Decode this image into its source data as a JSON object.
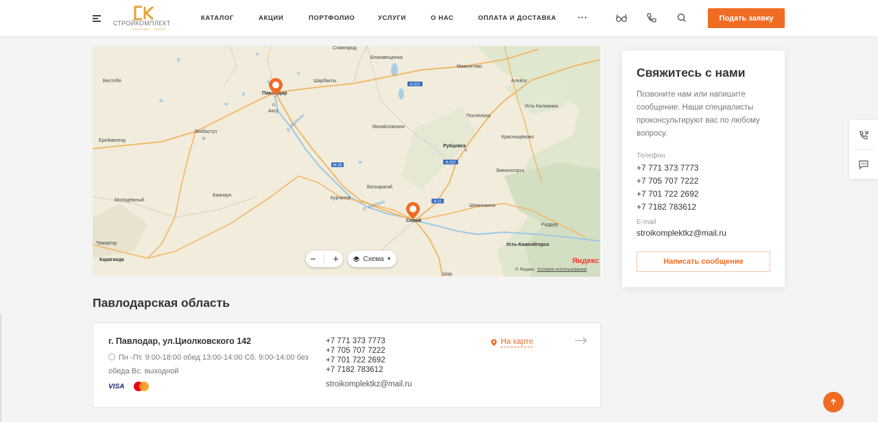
{
  "header": {
    "logo_text": "СТРОЙКОМПЛЕКТ",
    "logo_sub": "ПАВЛОДАР · СЕМЕЙ",
    "nav": [
      "КАТАЛОГ",
      "АКЦИИ",
      "ПОРТФОЛИО",
      "УСЛУГИ",
      "О НАС",
      "ОПЛАТА И ДОСТАВКА"
    ],
    "more": "···",
    "apply_button": "Подать заявку",
    "icons": [
      "menu-icon",
      "glasses-icon",
      "phone-icon",
      "search-icon"
    ]
  },
  "map": {
    "labels": [
      "Бестобе",
      "Павлодар",
      "Аксу",
      "Шарбакты",
      "Благовещенка",
      "Мамонтово",
      "Алейск",
      "Усть-Калманка",
      "Экибастуз",
      "Ерейментау",
      "Михайловское",
      "Поспелиха",
      "Рубцовск",
      "Краснощёково",
      "Змеиногорск",
      "Бескарагай",
      "Баянаул",
      "Курчатов",
      "Молодёжный",
      "Шемонаиха",
      "Семей",
      "Риддер",
      "Темиртау",
      "Караганда",
      "Усть-Каменогорск",
      "Шар",
      "Славгород",
      "р. Иртыш"
    ],
    "roads": [
      "А-321",
      "М-38",
      "А-322",
      "А-11"
    ],
    "zoom_out": "−",
    "zoom_in": "+",
    "scheme_label": "Схема",
    "yandex": "Яндекс",
    "copyright": "© Яндекс",
    "terms": "Условия использования"
  },
  "region": {
    "title": "Павлодарская область"
  },
  "office": {
    "address": "г. Павлодар, ул.Циолковского 142",
    "hours": "Пн -Пт. 9:00-18:00 обед 13:00-14:00 Сб. 9:00-14:00 без обеда Вс. выходной",
    "phones": [
      "+7 771 373 7773",
      "+7 705 707 7222",
      "+7 701 722 2692",
      "+7 7182 783612"
    ],
    "email": "stroikomplektkz@mail.ru",
    "on_map": "На карте",
    "payments": [
      "VISA",
      "mastercard-icon"
    ]
  },
  "contact": {
    "title": "Свяжитесь с нами",
    "description": "Позвоните нам или напишите сообщение. Наши специалисты проконсультируют вас по любому вопросу.",
    "phone_label": "Телефон",
    "phones": [
      "+7 771 373 7773",
      "+7 705 707 7222",
      "+7 701 722 2692",
      "+7 7182 783612"
    ],
    "email_label": "E-mail",
    "email": "stroikomplektkz@mail.ru",
    "write_button": "Написать сообщение"
  },
  "colors": {
    "accent": "#f06b24",
    "map_bg": "#f1ecdc"
  }
}
